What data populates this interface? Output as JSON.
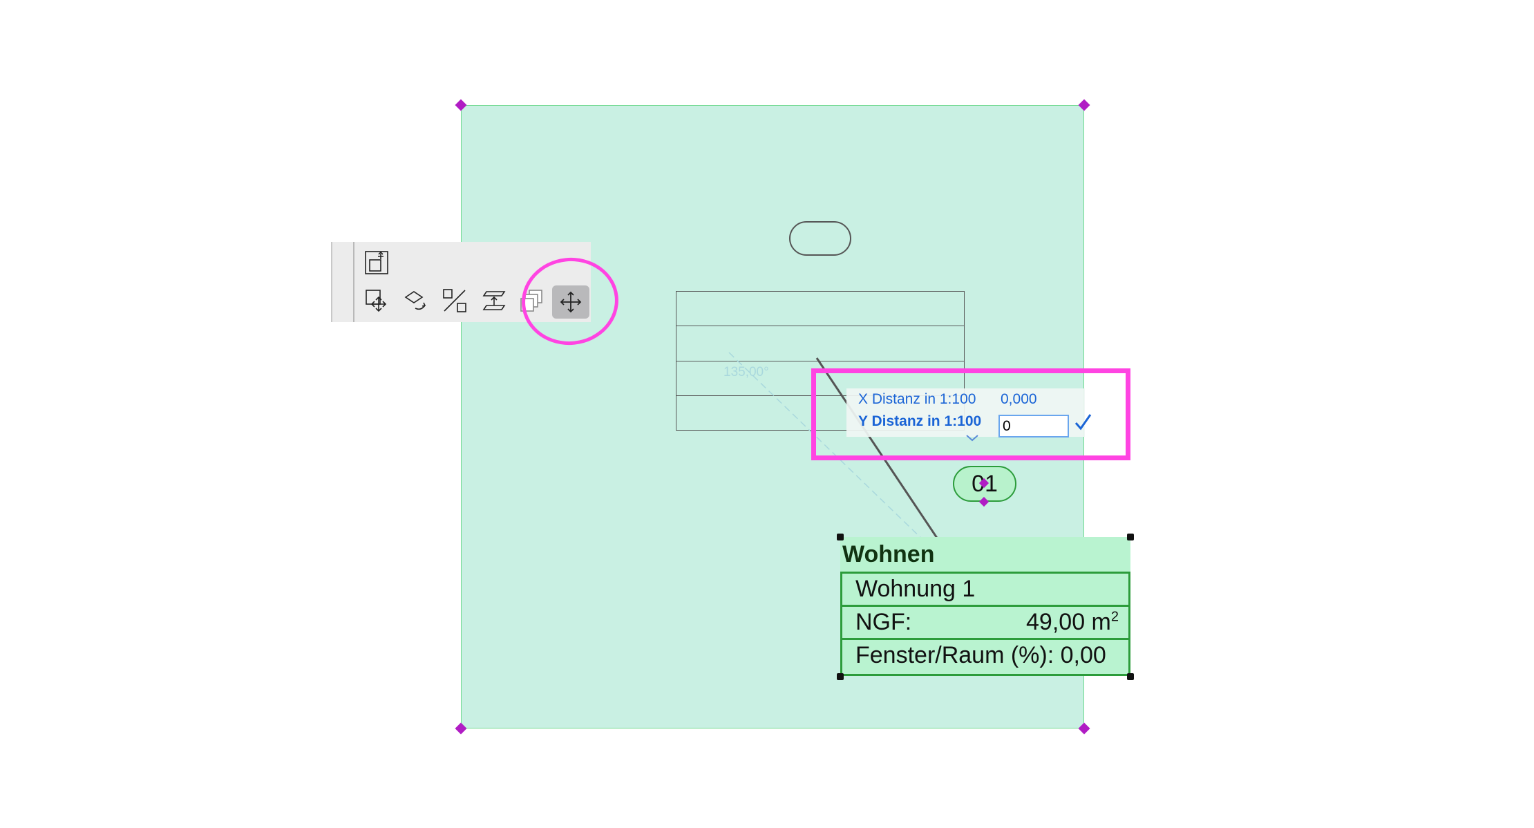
{
  "colors": {
    "room_fill": "#c9f0e3",
    "room_border": "#6fd98f",
    "hotspot_magenta": "#b01cc4",
    "highlight_pink": "#ff44e2",
    "tracker_blue": "#1a64d6",
    "stamp_green": "#2c9c3b"
  },
  "drawing": {
    "angle_label": "135,00°"
  },
  "pet_palette": {
    "top_tool": {
      "icon": "drag-palette-icon"
    },
    "tools": [
      {
        "icon": "drag-icon",
        "active": false
      },
      {
        "icon": "rotate-icon",
        "active": false
      },
      {
        "icon": "mirror-icon",
        "active": false
      },
      {
        "icon": "elevate-icon",
        "active": false
      },
      {
        "icon": "multiply-icon",
        "active": false
      },
      {
        "icon": "move-icon",
        "active": true
      }
    ]
  },
  "tracker": {
    "x_label": "X Distanz in 1:100",
    "x_value": "0,000",
    "y_label": "Y Distanz in 1:100",
    "y_value": "0"
  },
  "room_number": "01",
  "zone_stamp": {
    "title": "Wohnen",
    "name": "Wohnung 1",
    "ngf_label": "NGF:",
    "ngf_value": "49,00 m",
    "ngf_unit_sup": "2",
    "window_ratio": "Fenster/Raum (%): 0,00"
  }
}
